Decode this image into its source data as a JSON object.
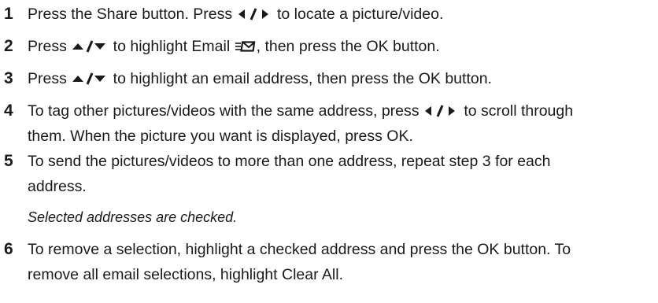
{
  "steps": [
    {
      "number": "1",
      "segments": [
        "Press the Share button. Press ",
        " to locate a picture/video."
      ]
    },
    {
      "number": "2",
      "segments": [
        "Press ",
        " to highlight Email ",
        ", then press the OK button."
      ]
    },
    {
      "number": "3",
      "segments": [
        "Press ",
        " to highlight an email address, then press the OK button."
      ]
    },
    {
      "number": "4",
      "lines": [
        [
          "To tag other pictures/videos with the same address, press ",
          " to scroll through"
        ],
        [
          "them. When the picture you want is displayed, press OK."
        ]
      ]
    },
    {
      "number": "5",
      "lines": [
        [
          "To send the pictures/videos to more than one address, repeat step 3 for each"
        ],
        [
          "address."
        ]
      ],
      "note": "Selected addresses are checked."
    },
    {
      "number": "6",
      "lines": [
        [
          "To remove a selection, highlight a checked address and press the OK button. To"
        ],
        [
          "remove all email selections, highlight Clear All."
        ]
      ]
    }
  ],
  "icons": {
    "left_right": "left-right-arrows-icon",
    "up_down": "up-down-arrows-icon",
    "email": "email-icon"
  },
  "colors": {
    "text": "#1a1a1a",
    "icon": "#1a1a1a"
  }
}
